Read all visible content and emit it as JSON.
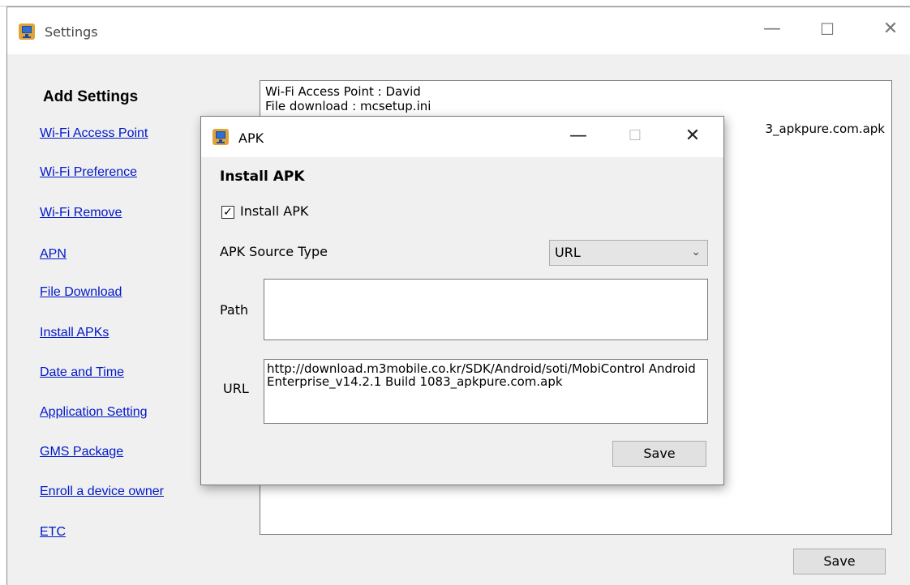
{
  "settings_window": {
    "title": "Settings",
    "controls": {
      "minimize": "—",
      "maximize": "☐",
      "close": "✕"
    }
  },
  "sidebar": {
    "title": "Add Settings",
    "items": [
      {
        "label": "Wi-Fi Access Point"
      },
      {
        "label": "Wi-Fi Preference"
      },
      {
        "label": "Wi-Fi Remove"
      },
      {
        "label": "APN"
      },
      {
        "label": "File Download"
      },
      {
        "label": "Install APKs"
      },
      {
        "label": "Date and Time"
      },
      {
        "label": "Application Setting"
      },
      {
        "label": "GMS Package"
      },
      {
        "label": "Enroll a device owner"
      },
      {
        "label": "ETC"
      }
    ]
  },
  "log": {
    "lines": [
      "Wi-Fi Access Point : David",
      "File download : mcsetup.ini"
    ],
    "partial_line": "3_apkpure.com.apk"
  },
  "main_save_label": "Save",
  "apk_dialog": {
    "title": "APK",
    "controls": {
      "minimize": "—",
      "maximize": "☐",
      "close": "✕"
    },
    "section_title": "Install APK",
    "checkbox_label": "Install APK",
    "checkbox_checked": true,
    "source_type_label": "APK Source Type",
    "source_type_value": "URL",
    "path_label": "Path",
    "path_value": "",
    "url_label": "URL",
    "url_value": "http://download.m3mobile.co.kr/SDK/Android/soti/MobiControl Android Enterprise_v14.2.1 Build 1083_apkpure.com.apk",
    "save_label": "Save"
  },
  "colors": {
    "link": "#0018c9",
    "titlebar": "#ffffff",
    "window_bg": "#f0f0f0"
  }
}
